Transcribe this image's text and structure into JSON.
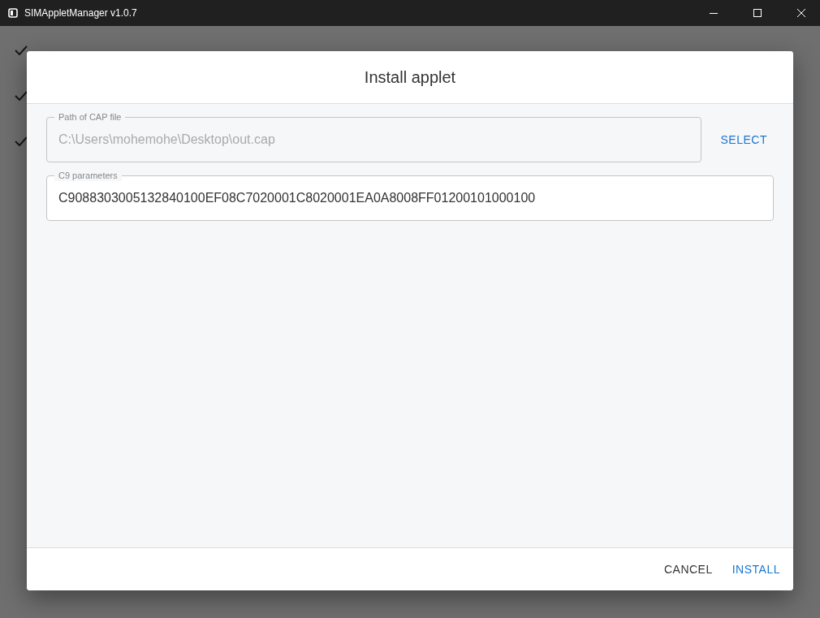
{
  "window": {
    "title": "SIMAppletManager v1.0.7"
  },
  "dialog": {
    "title": "Install applet",
    "fields": [
      {
        "label": "Path of CAP file",
        "value": "C:\\Users\\mohemohe\\Desktop\\out.cap",
        "disabled": true
      },
      {
        "label": "C9 parameters",
        "value": "C9088303005132840100EF08C7020001C8020001EA0A8008FF01200101000100",
        "disabled": false
      }
    ],
    "select_button": "SELECT",
    "buttons": [
      {
        "label": "CANCEL",
        "kind": "secondary"
      },
      {
        "label": "INSTALL",
        "kind": "primary"
      }
    ]
  }
}
